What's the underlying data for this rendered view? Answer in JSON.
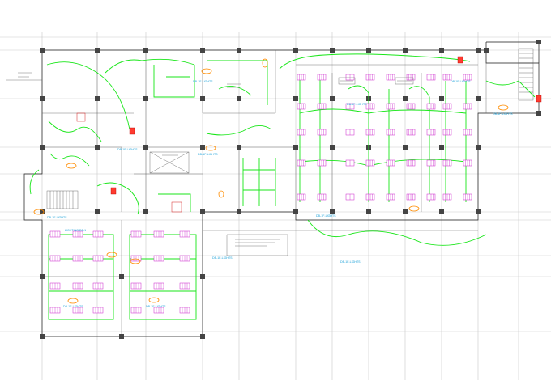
{
  "drawing": {
    "type": "electrical lighting floor plan",
    "colors": {
      "background": "#ffffff",
      "circuit": "#19e619",
      "fixture": "#cc22cc",
      "tag": "#ff8c00",
      "label": "#1aa0d8",
      "panel": "#ff3b30"
    }
  },
  "labels": {
    "circuit_tags": [
      "DB-1F-LIGHTS",
      "DB-1F-LIGHTS",
      "DB-1F-LIGHTS",
      "DB-1F-LIGHTS",
      "DB-1F-LIGHTS",
      "DB-1F-LIGHTS",
      "DB-1F-LIGHTS",
      "DB-1F-LIGHTS",
      "DB-1F-LIGHTS",
      "DB-1F-LIGHTS",
      "DB-1F-LIGHTS",
      "DB-1F-LIGHTS"
    ],
    "zone_label": "LIGHTING DB-1"
  }
}
